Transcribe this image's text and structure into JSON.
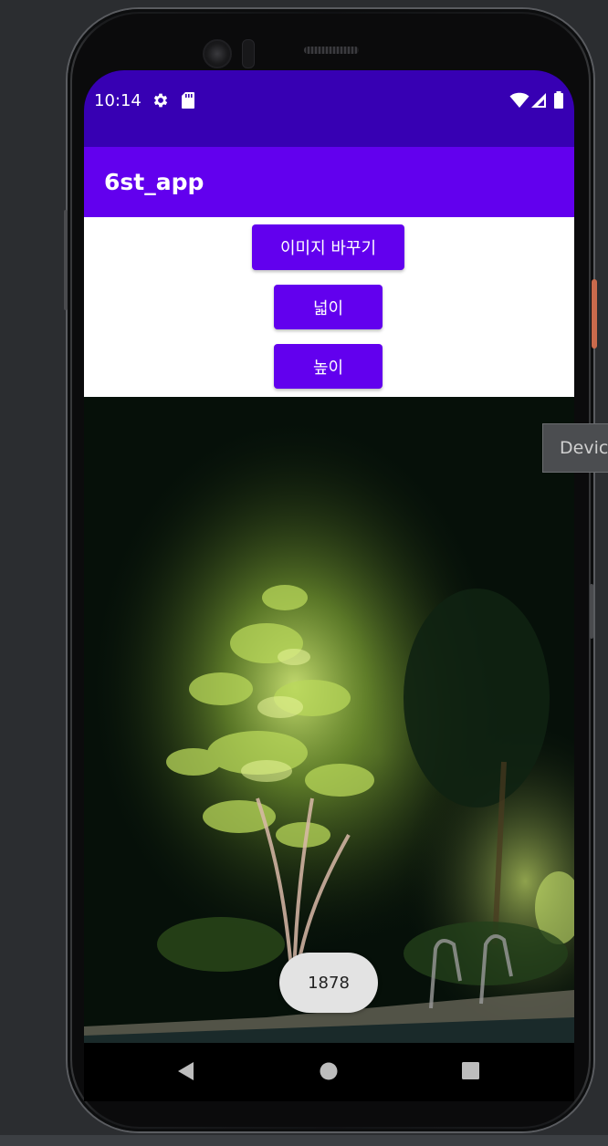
{
  "status_bar": {
    "time": "10:14",
    "left_icons": [
      "gear-icon",
      "sd-card-icon"
    ],
    "right_icons": [
      "wifi-icon",
      "cell-signal-icon",
      "battery-icon"
    ],
    "color": "#3700b3"
  },
  "app_bar": {
    "title": "6st_app",
    "color": "#6200ee"
  },
  "buttons": {
    "change_image": "이미지 바꾸기",
    "width": "넓이",
    "height": "높이"
  },
  "toast": {
    "text": "1878"
  },
  "nav_bar": {
    "icons": [
      "back-icon",
      "home-icon",
      "recents-icon"
    ]
  },
  "emulator": {
    "device_tab_label": "Device"
  }
}
